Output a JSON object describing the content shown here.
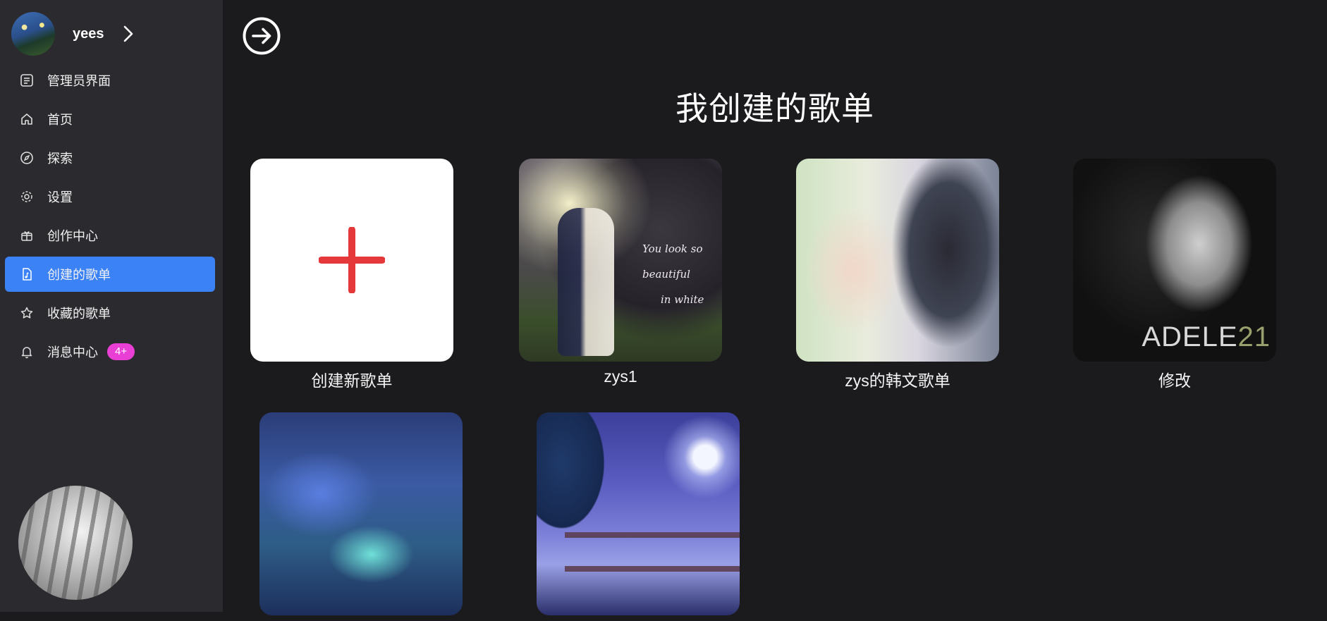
{
  "user": {
    "name": "yees"
  },
  "nav": [
    {
      "label": "管理员界面",
      "icon": "admin-list-icon",
      "active": false
    },
    {
      "label": "首页",
      "icon": "home-icon",
      "active": false
    },
    {
      "label": "探索",
      "icon": "compass-icon",
      "active": false
    },
    {
      "label": "设置",
      "icon": "gear-icon",
      "active": false
    },
    {
      "label": "创作中心",
      "icon": "gift-icon",
      "active": false
    },
    {
      "label": "创建的歌单",
      "icon": "music-file-icon",
      "active": true
    },
    {
      "label": "收藏的歌单",
      "icon": "star-icon",
      "active": false
    },
    {
      "label": "消息中心",
      "icon": "bell-icon",
      "active": false,
      "badge": "4+"
    }
  ],
  "main": {
    "title": "我创建的歌单",
    "playlists": [
      {
        "label": "创建新歌单",
        "kind": "new"
      },
      {
        "label": "zys1",
        "cover_text": [
          "You look so beautiful",
          "in white"
        ]
      },
      {
        "label": "zys的韩文歌单"
      },
      {
        "label": "修改",
        "cover_text": [
          "ADELE",
          "21"
        ]
      },
      {
        "label": ""
      },
      {
        "label": ""
      }
    ]
  },
  "colors": {
    "accent": "#3b82f6",
    "badge": "#e93fd4",
    "plus": "#e5383b",
    "sidebar_bg": "#2b2a2e",
    "page_bg": "#1b1a1d"
  }
}
